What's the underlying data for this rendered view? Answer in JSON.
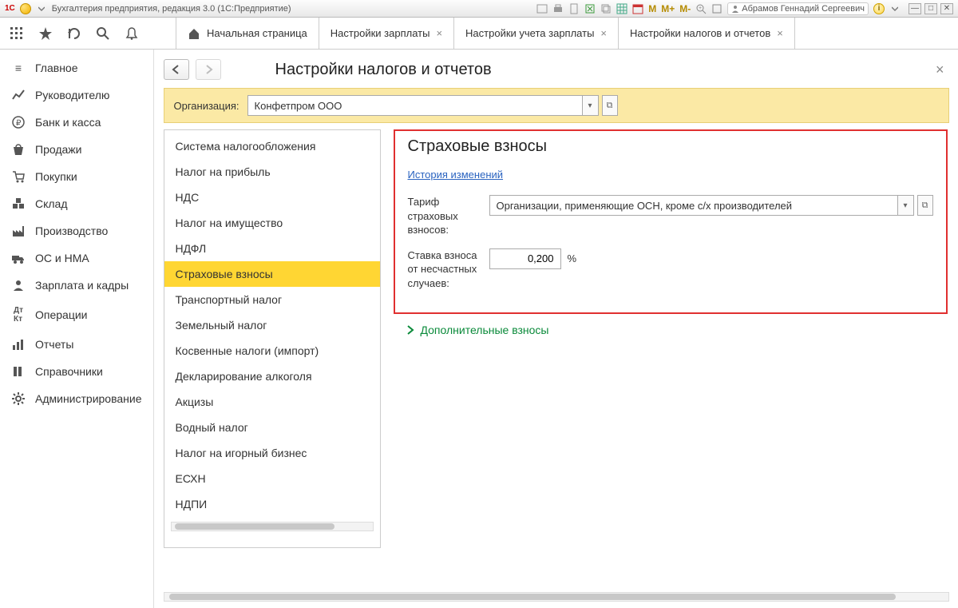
{
  "titlebar": {
    "brand": "1C",
    "app_title": "Бухгалтерия предприятия, редакция 3.0  (1С:Предприятие)",
    "user_name": "Абрамов Геннадий Сергеевич",
    "m1": "M",
    "m2": "M+",
    "m3": "M-"
  },
  "tabs": {
    "home": "Начальная страница",
    "t1": "Настройки зарплаты",
    "t2": "Настройки учета зарплаты",
    "t3": "Настройки налогов и отчетов"
  },
  "sidebar": {
    "items": [
      {
        "label": "Главное"
      },
      {
        "label": "Руководителю"
      },
      {
        "label": "Банк и касса"
      },
      {
        "label": "Продажи"
      },
      {
        "label": "Покупки"
      },
      {
        "label": "Склад"
      },
      {
        "label": "Производство"
      },
      {
        "label": "ОС и НМА"
      },
      {
        "label": "Зарплата и кадры"
      },
      {
        "label": "Операции"
      },
      {
        "label": "Отчеты"
      },
      {
        "label": "Справочники"
      },
      {
        "label": "Администрирование"
      }
    ]
  },
  "main": {
    "title": "Настройки налогов и отчетов",
    "org_label": "Организация:",
    "org_value": "Конфетпром ООО"
  },
  "categories": [
    "Система налогообложения",
    "Налог на прибыль",
    "НДС",
    "Налог на имущество",
    "НДФЛ",
    "Страховые взносы",
    "Транспортный налог",
    "Земельный налог",
    "Косвенные налоги (импорт)",
    "Декларирование алкоголя",
    "Акцизы",
    "Водный налог",
    "Налог на игорный бизнес",
    "ЕСХН",
    "НДПИ"
  ],
  "sel_category_index": 5,
  "section": {
    "title": "Страховые взносы",
    "history_link": "История изменений",
    "tarif_label": "Тариф страховых взносов:",
    "tarif_value": "Организации, применяющие ОСН, кроме с/х производителей",
    "rate_label": "Ставка взноса от несчастных случаев:",
    "rate_value": "0,200",
    "rate_unit": "%",
    "extra": "Дополнительные взносы"
  }
}
